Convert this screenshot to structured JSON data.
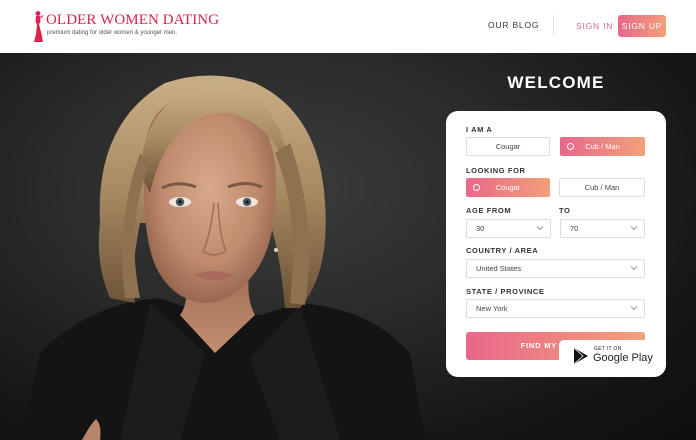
{
  "header": {
    "logo_title": "OLDER WOMEN DATING",
    "logo_tagline": "premium dating for older women & younger men.",
    "nav": {
      "blog": "OUR BLOG",
      "sign_in": "SIGN IN",
      "sign_up": "SIGN UP"
    }
  },
  "hero": {
    "welcome": "WELCOME"
  },
  "search": {
    "i_am_label": "I AM A",
    "i_am_options": [
      "Cougar",
      "Cub / Man"
    ],
    "i_am_selected": "Cub / Man",
    "looking_for_label": "LOOKING FOR",
    "looking_for_options": [
      "Cougar",
      "Cub / Man"
    ],
    "looking_for_selected": "Cougar",
    "age_from_label": "AGE FROM",
    "age_from_value": "30",
    "age_to_label": "TO",
    "age_to_value": "70",
    "country_label": "COUNTRY / AREA",
    "country_value": "United States",
    "state_label": "STATE / PROVINCE",
    "state_value": "New York",
    "submit_label": "FIND MY MATCH"
  },
  "app_badge": {
    "small_text": "GET IT ON",
    "store_name": "Google Play"
  },
  "colors": {
    "brand_red": "#d8234b",
    "gradient_start": "#e8688a",
    "gradient_end": "#f2a07a"
  }
}
